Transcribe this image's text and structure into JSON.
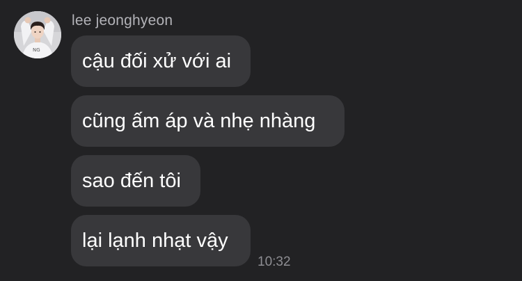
{
  "conversation": {
    "sender_name": "lee jeonghyeon",
    "avatar_icon": "profile-photo-avatar",
    "messages": [
      {
        "text": "cậu đối xử với ai"
      },
      {
        "text": "cũng ấm áp và nhẹ nhàng"
      },
      {
        "text": "sao đến tôi"
      },
      {
        "text": "lại lạnh nhạt vậy"
      }
    ],
    "timestamp": "10:32"
  },
  "colors": {
    "background": "#222224",
    "bubble": "#38383b",
    "message_text": "#ffffff",
    "sender_text": "#b3b3b8",
    "timestamp_text": "#8e8e93"
  }
}
